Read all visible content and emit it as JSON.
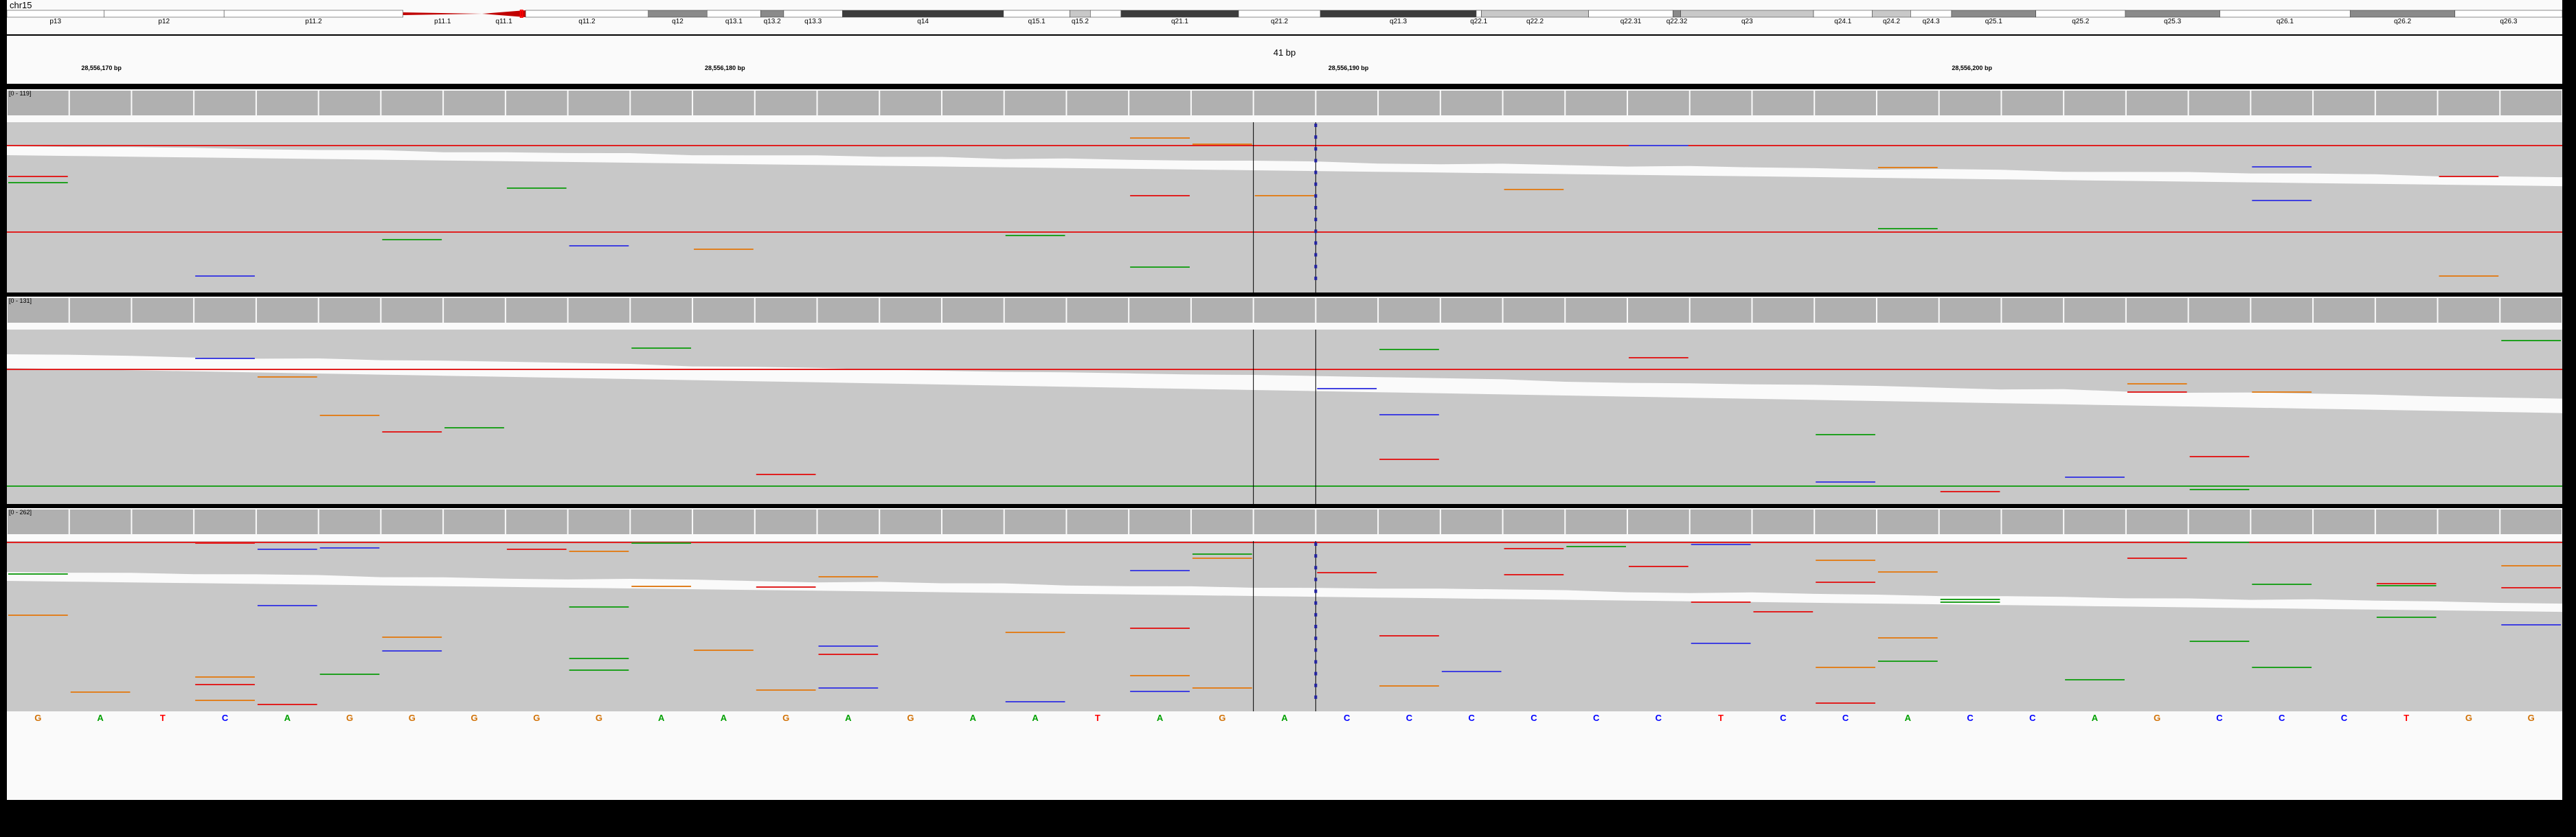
{
  "chromosome": "chr15",
  "bands": [
    {
      "name": "p13",
      "start": 0,
      "end": 0.038,
      "color": "#ffffff",
      "label": true
    },
    {
      "name": "p12",
      "start": 0.038,
      "end": 0.085,
      "color": "#ffffff",
      "label": true
    },
    {
      "name": "p11.2",
      "start": 0.085,
      "end": 0.155,
      "color": "#ffffff",
      "label": true
    },
    {
      "name": "p11.1",
      "start": 0.155,
      "end": 0.186,
      "color": "#c00000",
      "label": true,
      "cen": "left"
    },
    {
      "name": "q11.1",
      "start": 0.186,
      "end": 0.203,
      "color": "#c00000",
      "label": true,
      "cen": "right"
    },
    {
      "name": "q11.2",
      "start": 0.203,
      "end": 0.251,
      "color": "#ffffff",
      "label": true
    },
    {
      "name": "q12",
      "start": 0.251,
      "end": 0.274,
      "color": "#8a8a8a",
      "label": true
    },
    {
      "name": "q13.1",
      "start": 0.274,
      "end": 0.295,
      "color": "#ffffff",
      "label": true
    },
    {
      "name": "q13.2",
      "start": 0.295,
      "end": 0.304,
      "color": "#8a8a8a",
      "label": true
    },
    {
      "name": "q13.3",
      "start": 0.304,
      "end": 0.327,
      "color": "#ffffff",
      "label": true
    },
    {
      "name": "q14",
      "start": 0.327,
      "end": 0.39,
      "color": "#3c3c3c",
      "label": true
    },
    {
      "name": "q15.1",
      "start": 0.39,
      "end": 0.416,
      "color": "#ffffff",
      "label": true
    },
    {
      "name": "q15.2",
      "start": 0.416,
      "end": 0.424,
      "color": "#c8c8c8",
      "label": true
    },
    {
      "name": "",
      "start": 0.424,
      "end": 0.436,
      "color": "#ffffff",
      "label": false
    },
    {
      "name": "q21.1",
      "start": 0.436,
      "end": 0.482,
      "color": "#3c3c3c",
      "label": true
    },
    {
      "name": "q21.2",
      "start": 0.482,
      "end": 0.514,
      "color": "#ffffff",
      "label": true
    },
    {
      "name": "q21.3",
      "start": 0.514,
      "end": 0.575,
      "color": "#3c3c3c",
      "label": true
    },
    {
      "name": "q22.1",
      "start": 0.575,
      "end": 0.577,
      "color": "#ffffff",
      "label": true
    },
    {
      "name": "q22.2",
      "start": 0.577,
      "end": 0.619,
      "color": "#c8c8c8",
      "label": true
    },
    {
      "name": "q22.31",
      "start": 0.619,
      "end": 0.652,
      "color": "#ffffff",
      "label": true
    },
    {
      "name": "q22.32",
      "start": 0.652,
      "end": 0.655,
      "color": "#8a8a8a",
      "label": true
    },
    {
      "name": "q23",
      "start": 0.655,
      "end": 0.707,
      "color": "#c8c8c8",
      "label": true
    },
    {
      "name": "q24.1",
      "start": 0.707,
      "end": 0.73,
      "color": "#ffffff",
      "label": true
    },
    {
      "name": "q24.2",
      "start": 0.73,
      "end": 0.745,
      "color": "#c8c8c8",
      "label": true
    },
    {
      "name": "q24.3",
      "start": 0.745,
      "end": 0.761,
      "color": "#ffffff",
      "label": true
    },
    {
      "name": "q25.1",
      "start": 0.761,
      "end": 0.794,
      "color": "#8a8a8a",
      "label": true
    },
    {
      "name": "q25.2",
      "start": 0.794,
      "end": 0.829,
      "color": "#ffffff",
      "label": true
    },
    {
      "name": "q25.3",
      "start": 0.829,
      "end": 0.866,
      "color": "#8a8a8a",
      "label": true
    },
    {
      "name": "q26.1",
      "start": 0.866,
      "end": 0.917,
      "color": "#ffffff",
      "label": true
    },
    {
      "name": "q26.2",
      "start": 0.917,
      "end": 0.958,
      "color": "#8a8a8a",
      "label": true
    },
    {
      "name": "q26.3",
      "start": 0.958,
      "end": 1.0,
      "color": "#ffffff",
      "label": true
    }
  ],
  "ruler": {
    "span_label": "41 bp",
    "ticks": [
      {
        "label": "28,556,170 bp",
        "fraction": 0.037
      },
      {
        "label": "",
        "fraction": 0.158
      },
      {
        "label": "28,556,180 bp",
        "fraction": 0.281
      },
      {
        "label": "",
        "fraction": 0.403
      },
      {
        "label": "28,556,190 bp",
        "fraction": 0.525
      },
      {
        "label": "",
        "fraction": 0.647
      },
      {
        "label": "28,556,200 bp",
        "fraction": 0.769
      },
      {
        "label": "",
        "fraction": 0.891
      }
    ]
  },
  "tracks": [
    {
      "range": "[0 - 119]",
      "name": "alignment-track-1"
    },
    {
      "range": "[0 - 131]",
      "name": "alignment-track-2"
    },
    {
      "range": "[0 - 262]",
      "name": "alignment-track-3"
    }
  ],
  "sequence": [
    "G",
    "A",
    "T",
    "C",
    "A",
    "G",
    "G",
    "G",
    "G",
    "G",
    "A",
    "A",
    "G",
    "A",
    "G",
    "A",
    "A",
    "T",
    "A",
    "G",
    "A",
    "C",
    "C",
    "C",
    "C",
    "C",
    "C",
    "T",
    "C",
    "C",
    "A",
    "C",
    "C",
    "A",
    "G",
    "C",
    "C",
    "C",
    "T",
    "G",
    "G"
  ],
  "base_colors": {
    "A": "#00a000",
    "C": "#0000ff",
    "G": "#d17105",
    "T": "#ff0000"
  },
  "colors": {
    "read": "#c8c8c8",
    "coverage": "#b0b0b0",
    "mismatch_blue": "#4040e0",
    "mismatch_red": "#e02020",
    "mismatch_green": "#20a020",
    "mismatch_orange": "#e08020"
  }
}
